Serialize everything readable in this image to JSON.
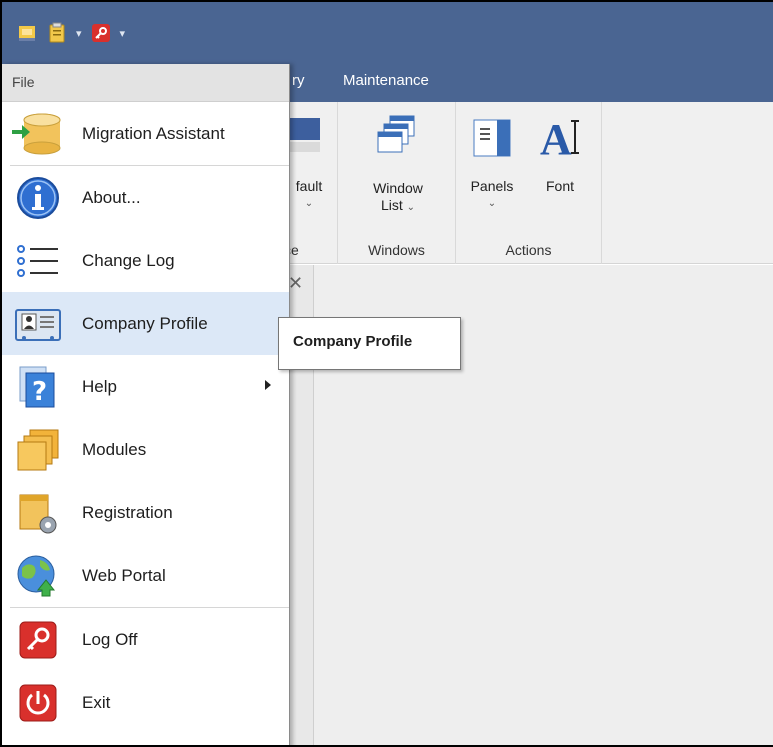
{
  "quick_access": {
    "icons": [
      "app-logo-icon",
      "clipboard-icon",
      "logoff-icon"
    ],
    "dropdown_caret": "▾"
  },
  "tabs": {
    "partial_tab": "ry",
    "maintenance": "Maintenance"
  },
  "ribbon": {
    "partial_group_label": "ce",
    "partial_button_label": "fault",
    "window_list_line1": "Window",
    "window_list_line2": "List",
    "windows_group": "Windows",
    "panels": "Panels",
    "font": "Font",
    "actions_group": "Actions"
  },
  "file_menu": {
    "header": "File",
    "items": [
      {
        "label": "Migration Assistant",
        "icon": "database-arrow-icon"
      },
      {
        "label": "About...",
        "icon": "info-icon"
      },
      {
        "label": "Change Log",
        "icon": "list-icon"
      },
      {
        "label": "Company Profile",
        "icon": "profile-card-icon",
        "hovered": true
      },
      {
        "label": "Help",
        "icon": "help-book-icon",
        "has_submenu": true
      },
      {
        "label": "Modules",
        "icon": "modules-icon"
      },
      {
        "label": "Registration",
        "icon": "registration-gear-icon"
      },
      {
        "label": "Web Portal",
        "icon": "globe-icon"
      },
      {
        "label": "Log Off",
        "icon": "key-icon"
      },
      {
        "label": "Exit",
        "icon": "power-icon"
      }
    ]
  },
  "tooltip": {
    "text": "Company Profile"
  },
  "colors": {
    "title_bar": "#4a6592",
    "menu_hover": "#dce8f7",
    "ribbon_bg": "#f0f0f0"
  }
}
